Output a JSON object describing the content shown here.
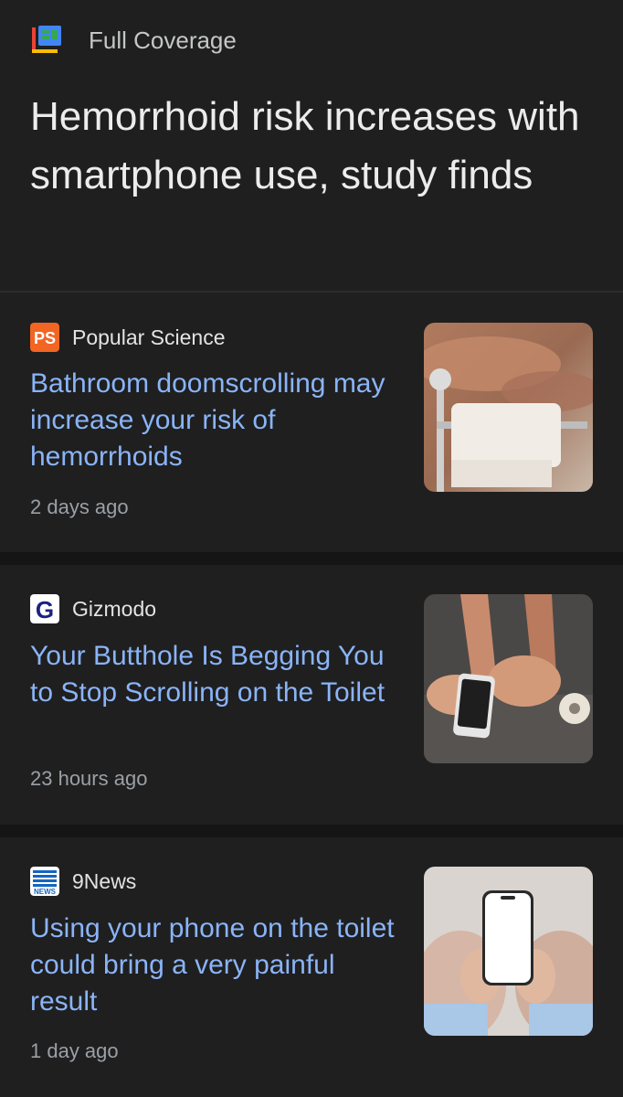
{
  "header": {
    "section_label": "Full Coverage",
    "logo_icon": "google-news-full-coverage-icon",
    "title": "Hemorrhoid risk increases with smartphone use, study finds"
  },
  "articles": [
    {
      "source": "Popular Science",
      "source_icon": "popular-science-icon",
      "headline": "Bathroom doomscrolling may increase your risk of hemorrhoids",
      "time": "2 days ago",
      "thumbnail": "toilet-paper-holder-photo"
    },
    {
      "source": "Gizmodo",
      "source_icon": "gizmodo-icon",
      "headline": "Your Butthole Is Begging You to Stop Scrolling on the Toilet",
      "time": "23 hours ago",
      "thumbnail": "phone-on-toilet-photo"
    },
    {
      "source": "9News",
      "source_icon": "9news-icon",
      "headline": "Using your phone on the toilet could bring a very painful result",
      "time": "1 day ago",
      "thumbnail": "hands-holding-phone-photo"
    }
  ],
  "colors": {
    "background": "#1f1f1f",
    "headline_link": "#8ab4f8",
    "secondary_text": "#9aa0a6",
    "separator": "#151515"
  }
}
